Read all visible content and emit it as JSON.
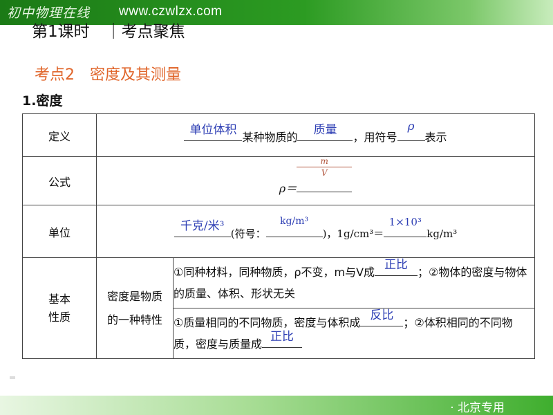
{
  "header": {
    "brand": "初中物理在线",
    "url": "www.czwlzx.com"
  },
  "lesson_title": "第1课时　｜考点聚焦",
  "section": {
    "heading": "考点2　密度及其测量",
    "subheading": "1.密度"
  },
  "table": {
    "definition": {
      "label": "定义",
      "blank1": "单位体积",
      "text1": "某种物质的",
      "blank2": "质量",
      "text2": "，用符号",
      "blank3": "ρ",
      "text3": "表示"
    },
    "formula": {
      "label": "公式",
      "lhs": "ρ＝",
      "numerator": "m",
      "denominator": "V"
    },
    "unit": {
      "label": "单位",
      "blank1": "千克/米³",
      "text1": "(符号：",
      "blank2": "kg/m³",
      "text2": ")，1g/cm³＝",
      "blank3": "1×10³",
      "text3": "kg/m³"
    },
    "property": {
      "label": "基本\n性质",
      "mid_label": "密度是物质的一种特性",
      "row1": {
        "text1": "①同种材料，同种物质，ρ不变，m与V成",
        "blank1": "正比",
        "text2": "；②物体的密度与物体的质量、体积、形状无关"
      },
      "row2": {
        "text1": "①质量相同的不同物质，密度与体积成",
        "blank1": "反比",
        "text2": "；②体积相同的不同物质，密度与质量成",
        "blank2": "正比"
      }
    }
  },
  "footer": {
    "text": "· 北京专用"
  },
  "colors": {
    "header_green": "#1b7a16",
    "heading_orange": "#e0652a",
    "answer_blue": "#2e3fb4"
  }
}
